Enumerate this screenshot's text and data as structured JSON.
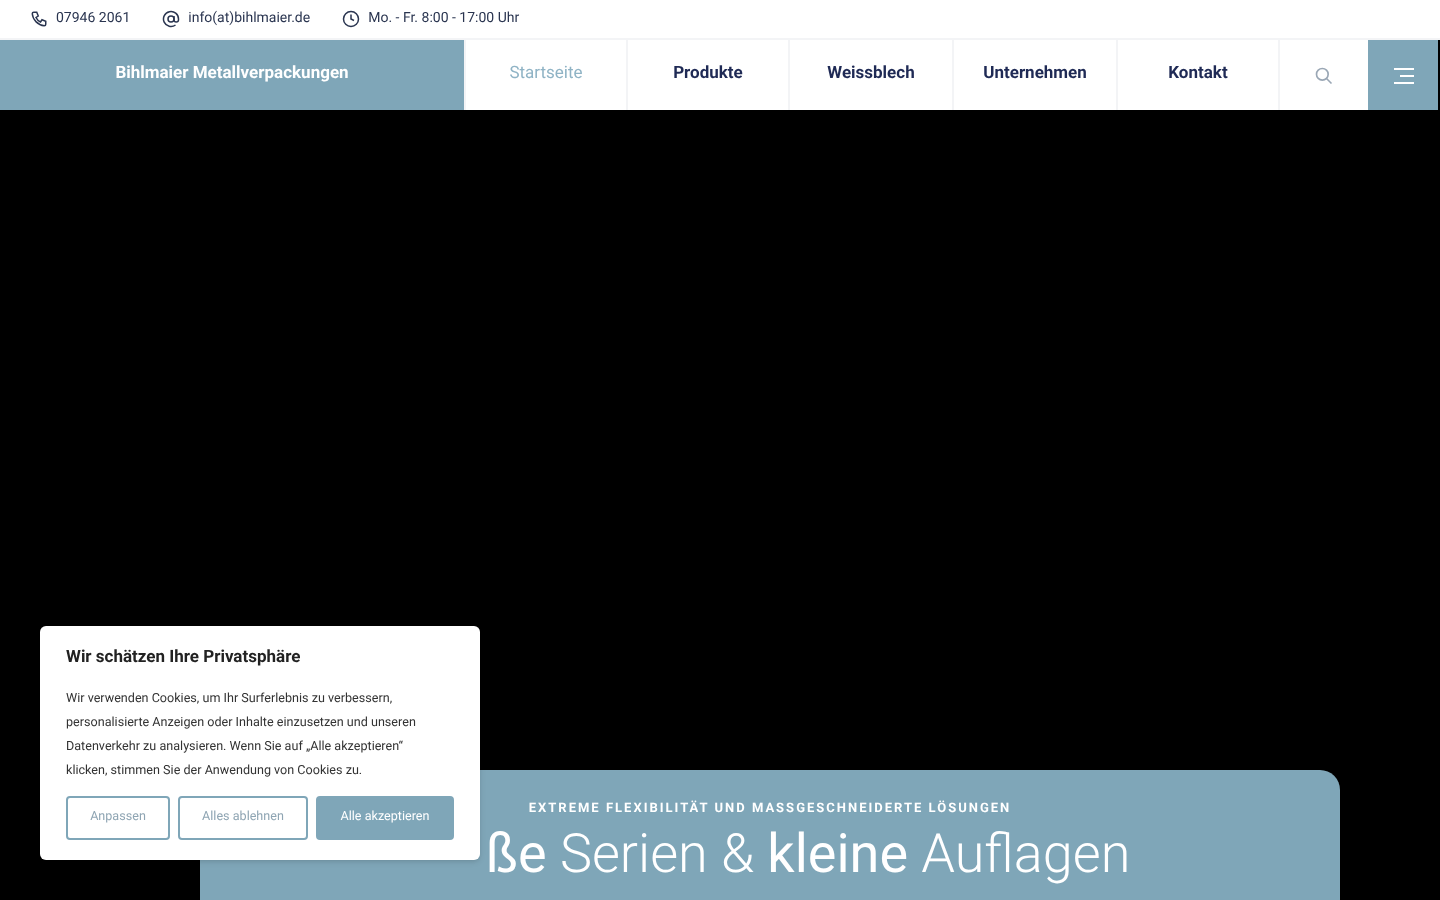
{
  "topbar": {
    "phone": "07946 2061",
    "email": "info(at)bihlmaier.de",
    "hours": "Mo. - Fr. 8:00 - 17:00 Uhr"
  },
  "brand": "Bihlmaier Metallverpackungen",
  "nav": [
    {
      "label": "Startseite",
      "selected": true
    },
    {
      "label": "Produkte",
      "selected": false
    },
    {
      "label": "Weissblech",
      "selected": false
    },
    {
      "label": "Unternehmen",
      "selected": false
    },
    {
      "label": "Kontakt",
      "selected": false
    }
  ],
  "hero": {
    "tagline": "EXTREME FLEXIBILITÄT UND MASSGESCHNEIDERTE LÖSUNGEN",
    "heading": "**ße** Serien & **kleine** Auflagen"
  },
  "cookie": {
    "title": "Wir schätzen Ihre Privatsphäre",
    "text": "Wir verwenden Cookies, um Ihr Surferlebnis zu verbessern, personalisierte Anzeigen oder Inhalte einzusetzen und unseren Datenverkehr zu analysieren. Wenn Sie auf „Alle akzeptieren“ klicken, stimmen Sie der Anwendung von Cookies zu.",
    "buttons": [
      {
        "label": "Anpassen",
        "kind": "outline"
      },
      {
        "label": "Alles ablehnen",
        "kind": "outline"
      },
      {
        "label": "Alle akzeptieren",
        "kind": "primary"
      }
    ]
  }
}
